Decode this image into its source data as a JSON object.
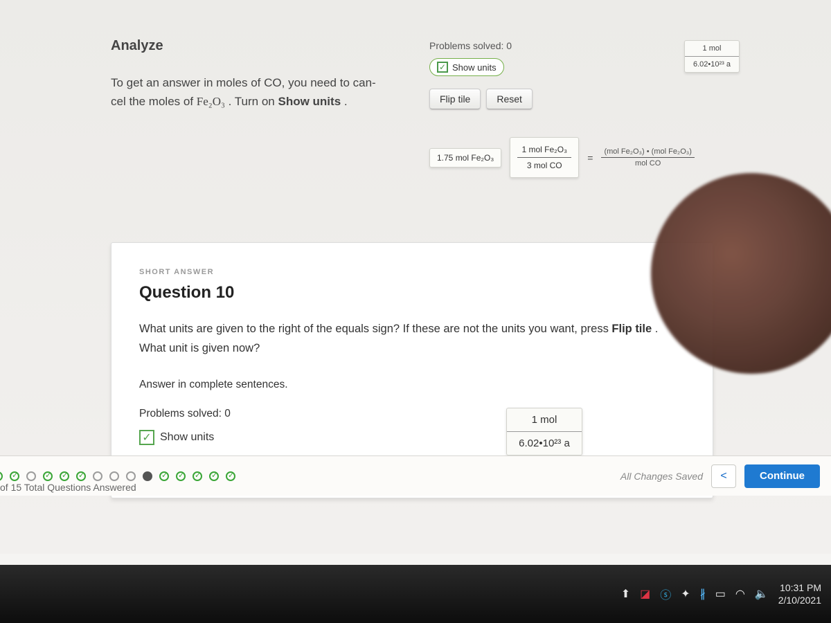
{
  "analyze": {
    "title": "Analyze",
    "text_pre": "To get an answer in moles of CO, you need to can-",
    "text_mid1": "cel the moles of ",
    "chem": "Fe₂O₃",
    "text_mid2": ". Turn on ",
    "bold": "Show units",
    "text_end": "."
  },
  "problem_widget": {
    "problems_solved": "Problems solved: 0",
    "show_units": "Show units",
    "flip_tile": "Flip tile",
    "reset": "Reset",
    "tile1": "1.75 mol Fe₂O₃",
    "tile2_top": "1 mol Fe₂O₃",
    "tile2_bot": "3 mol CO",
    "eq": "=",
    "result_top": "(mol Fe₂O₃) • (mol Fe₂O₃)",
    "result_bot": "mol CO",
    "right_tile_top": "1 mol",
    "right_tile_bot": "6.02•10²³ a"
  },
  "question": {
    "tag": "SHORT ANSWER",
    "title": "Question 10",
    "prompt_pre": "What units are given to the right of the equals sign? If these are not the units you want, press ",
    "prompt_bold": "Flip tile",
    "prompt_post": ". What unit is given now?",
    "answer_hint": "Answer in complete sentences.",
    "mini_probs": "Problems solved: 0",
    "mini_show_units": "Show units",
    "mini_tile_top": "1 mol",
    "mini_tile_bot": "6.02•10²³ a"
  },
  "footer": {
    "progress_text": "of 15 Total Questions Answered",
    "saved": "All Changes Saved",
    "back": "<",
    "continue": "Continue",
    "dots": [
      "checked",
      "checked",
      "empty",
      "checked",
      "checked",
      "checked",
      "empty",
      "empty",
      "empty",
      "current",
      "checked",
      "checked",
      "checked",
      "checked",
      "checked"
    ]
  },
  "taskbar": {
    "time": "10:31 PM",
    "date": "2/10/2021"
  }
}
